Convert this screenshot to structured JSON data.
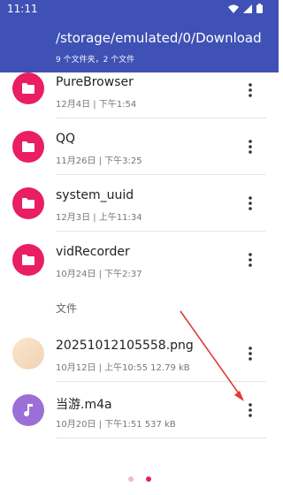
{
  "status_bar": {
    "time": "11:11"
  },
  "app_bar": {
    "path": "/storage/emulated/0/Download",
    "summary": "9 个文件夹，2 个文件"
  },
  "colors": {
    "primary": "#3f51b5",
    "folder_pink": "#e91e63",
    "audio_purple": "#9c6fd6",
    "image_peach": "#f6dcc0"
  },
  "folders": [
    {
      "name": "PureBrowser",
      "meta": "12月4日 | 下午1:54",
      "icon": "folder-icon"
    },
    {
      "name": "QQ",
      "meta": "11月26日 | 下午3:25",
      "icon": "folder-icon"
    },
    {
      "name": "system_uuid",
      "meta": "12月3日 | 上午11:34",
      "icon": "folder-icon"
    },
    {
      "name": "vidRecorder",
      "meta": "10月24日 | 下午2:37",
      "icon": "folder-icon"
    }
  ],
  "files_section_label": "文件",
  "files": [
    {
      "name": "20251012105558.png",
      "meta": "10月12日 | 上午10:55   12.79 kB",
      "icon": "image-thumbnail"
    },
    {
      "name": "当游.m4a",
      "meta": "10月20日 | 下午1:51   537 kB",
      "icon": "music-note-icon"
    }
  ]
}
